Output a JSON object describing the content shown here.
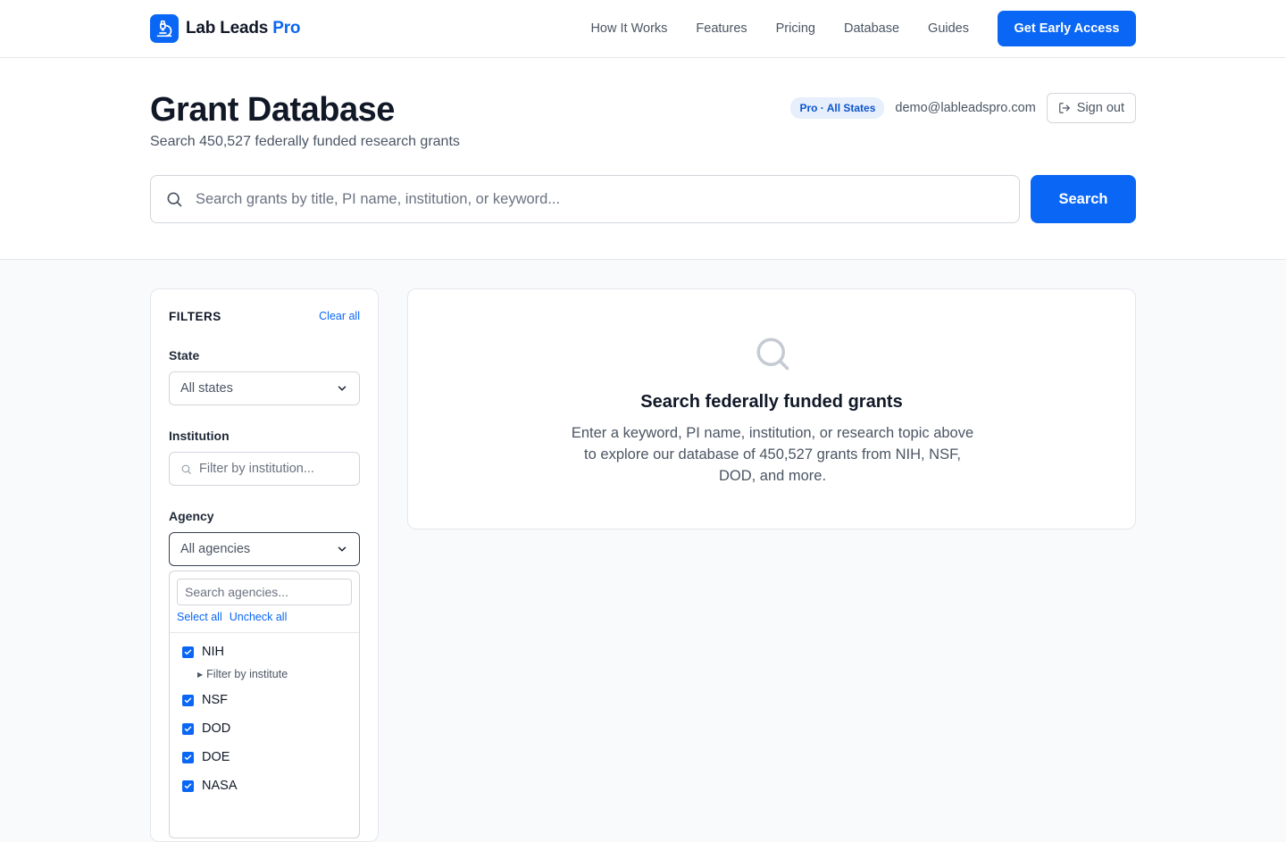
{
  "brand": {
    "name": "Lab Leads",
    "accent": "Pro",
    "logo_icon": "microscope-icon"
  },
  "nav": {
    "links": [
      "How It Works",
      "Features",
      "Pricing",
      "Database",
      "Guides"
    ],
    "cta_label": "Get Early Access"
  },
  "header": {
    "title": "Grant Database",
    "subtitle": "Search 450,527 federally funded research grants",
    "plan_badge": "Pro · All States",
    "email": "demo@lableadspro.com",
    "signout_label": "Sign out"
  },
  "search": {
    "placeholder": "Search grants by title, PI name, institution, or keyword...",
    "value": "",
    "button_label": "Search"
  },
  "filters": {
    "title": "FILTERS",
    "clear_all": "Clear all",
    "state": {
      "label": "State",
      "value": "All states"
    },
    "institution": {
      "label": "Institution",
      "placeholder": "Filter by institution..."
    },
    "agency": {
      "label": "Agency",
      "value": "All agencies",
      "search_placeholder": "Search agencies...",
      "select_all": "Select all",
      "uncheck_all": "Uncheck all",
      "sub_filter": "Filter by institute",
      "options": [
        {
          "label": "NIH",
          "checked": true
        },
        {
          "label": "NSF",
          "checked": true
        },
        {
          "label": "DOD",
          "checked": true
        },
        {
          "label": "DOE",
          "checked": true
        },
        {
          "label": "NASA",
          "checked": true
        }
      ]
    }
  },
  "empty_state": {
    "title": "Search federally funded grants",
    "text": "Enter a keyword, PI name, institution, or research topic above to explore our database of 450,527 grants from NIH, NSF, DOD, and more."
  },
  "colors": {
    "accent": "#0a66f5",
    "text": "#111827",
    "muted": "#4b5563",
    "border": "#e5e7eb"
  }
}
